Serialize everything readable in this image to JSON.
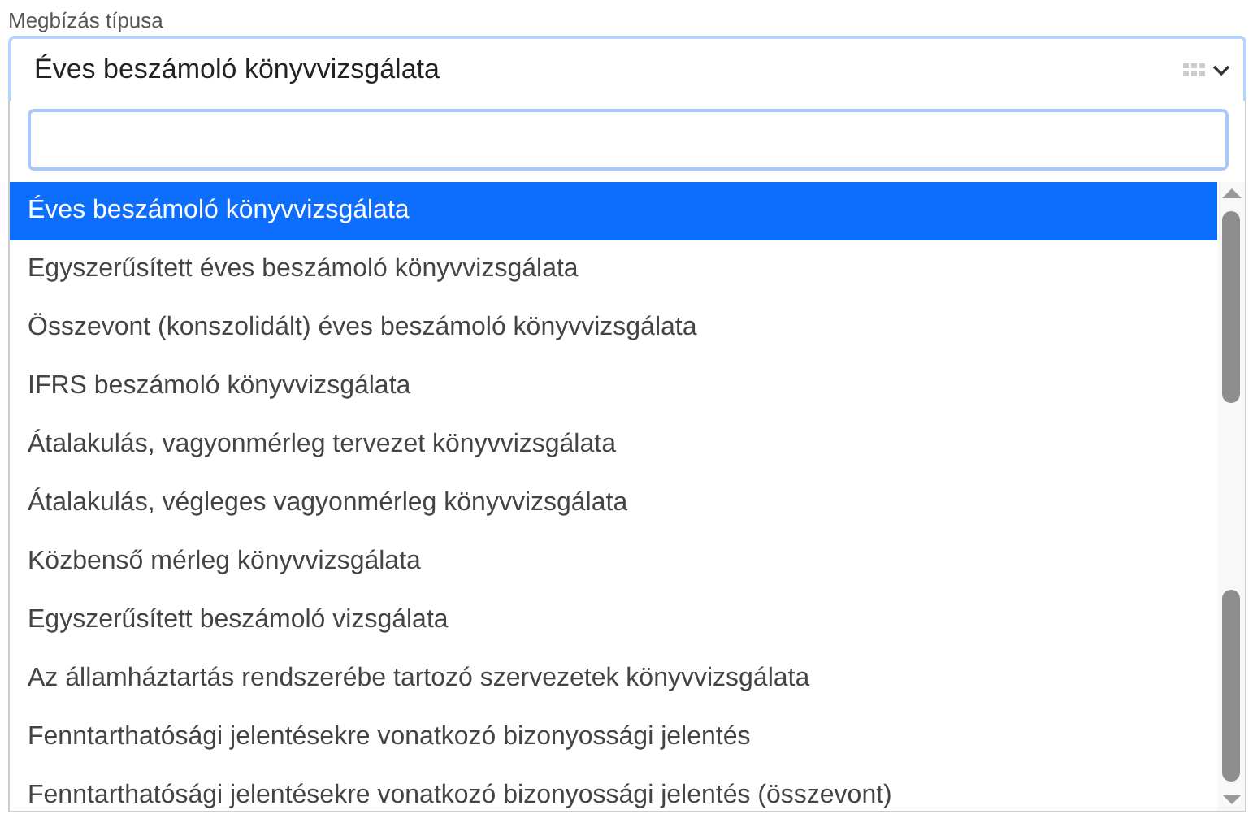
{
  "field": {
    "label": "Megbízás típusa",
    "value": "Éves beszámoló könyvvizsgálata"
  },
  "options": [
    {
      "label": "Éves beszámoló könyvvizsgálata",
      "selected": true
    },
    {
      "label": "Egyszerűsített éves beszámoló könyvvizsgálata",
      "selected": false
    },
    {
      "label": "Összevont (konszolidált) éves beszámoló könyvvizsgálata",
      "selected": false
    },
    {
      "label": "IFRS beszámoló könyvvizsgálata",
      "selected": false
    },
    {
      "label": "Átalakulás, vagyonmérleg tervezet könyvvizsgálata",
      "selected": false
    },
    {
      "label": "Átalakulás, végleges vagyonmérleg könyvvizsgálata",
      "selected": false
    },
    {
      "label": "Közbenső mérleg könyvvizsgálata",
      "selected": false
    },
    {
      "label": "Egyszerűsített beszámoló vizsgálata",
      "selected": false
    },
    {
      "label": "Az államháztartás rendszerébe tartozó szervezetek könyvvizsgálata",
      "selected": false
    },
    {
      "label": "Fenntarthatósági jelentésekre vonatkozó bizonyossági jelentés",
      "selected": false
    },
    {
      "label": "Fenntarthatósági jelentésekre vonatkozó bizonyossági jelentés (összevont)",
      "selected": false
    }
  ]
}
